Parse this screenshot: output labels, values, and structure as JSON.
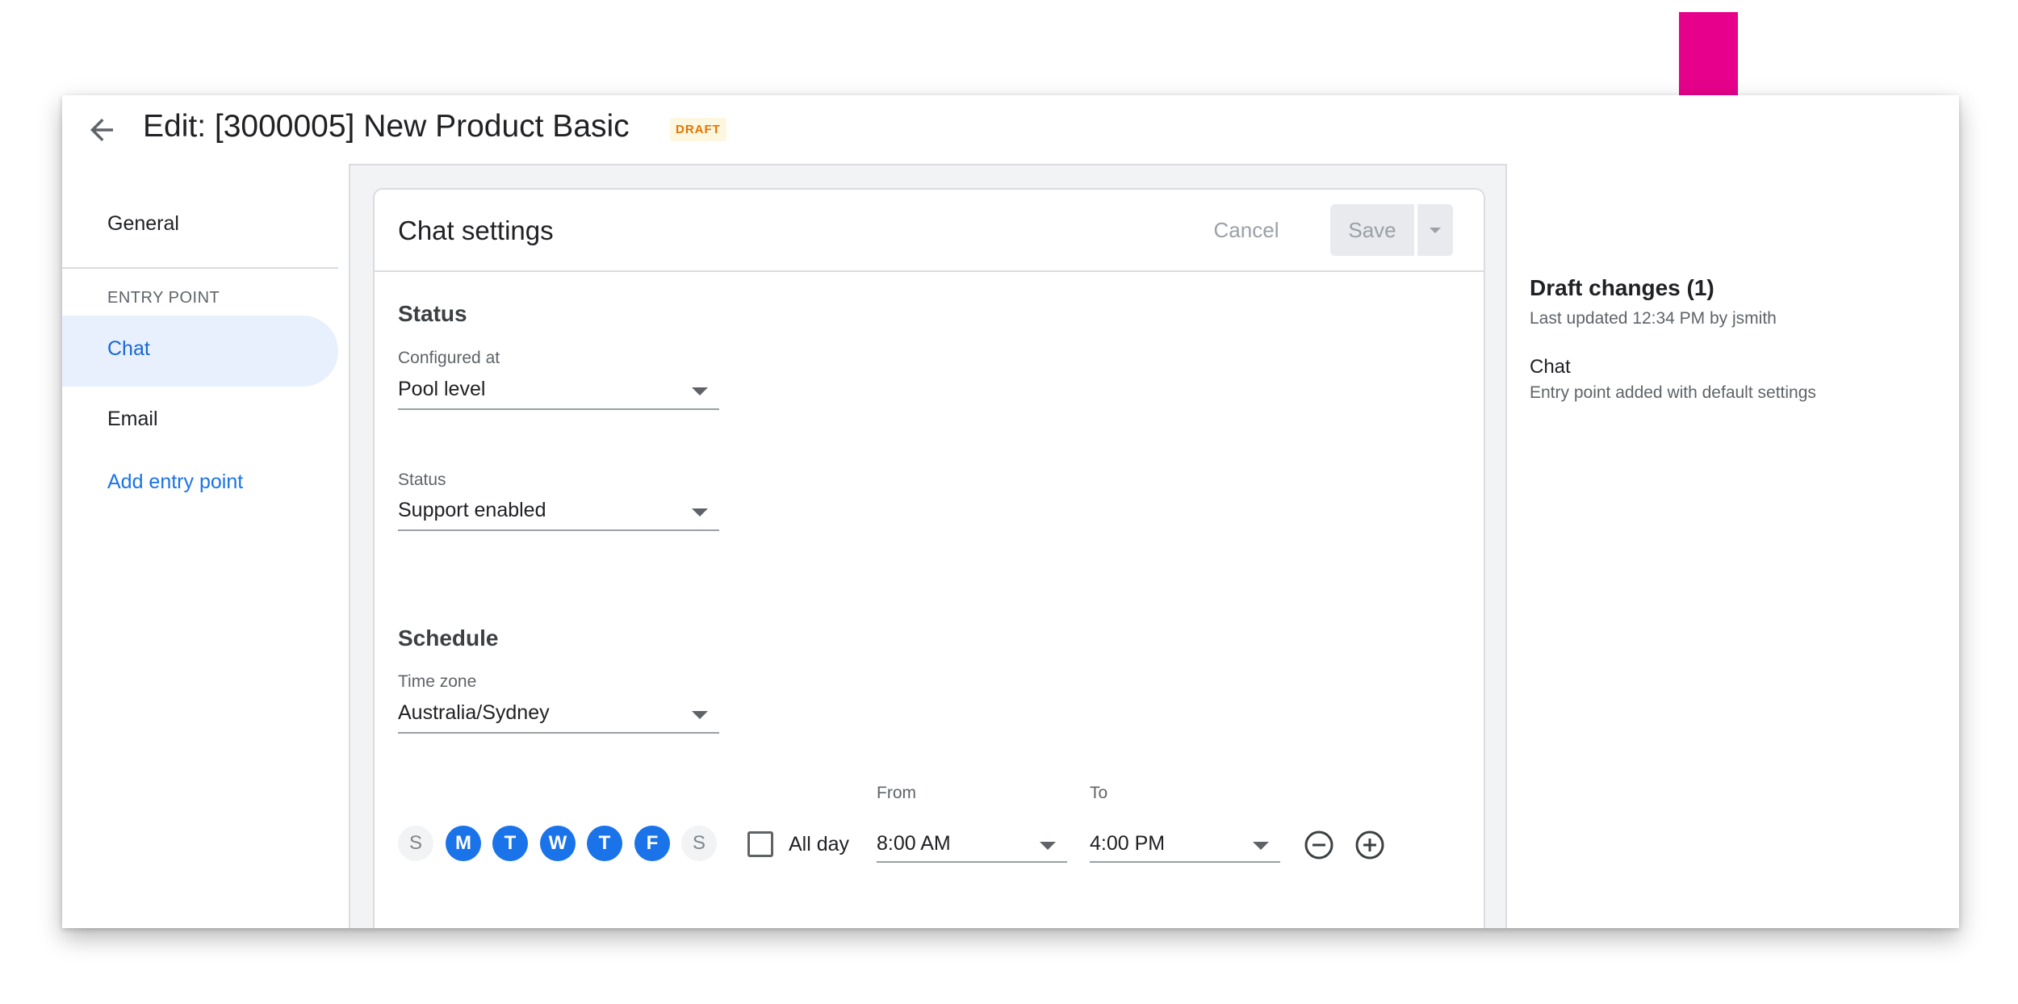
{
  "header": {
    "title": "Edit: [3000005] New Product Basic",
    "badge": "DRAFT"
  },
  "nav": {
    "general": "General",
    "section_label": "ENTRY POINT",
    "items": [
      {
        "label": "Chat",
        "selected": true
      },
      {
        "label": "Email",
        "selected": false
      }
    ],
    "add_label": "Add entry point"
  },
  "card": {
    "title": "Chat settings",
    "cancel_label": "Cancel",
    "save_label": "Save",
    "status_section": "Status",
    "configured_label": "Configured at",
    "configured_value": "Pool level",
    "status_label": "Status",
    "status_value": "Support enabled",
    "schedule_section": "Schedule",
    "timezone_label": "Time zone",
    "timezone_value": "Australia/Sydney",
    "days": [
      {
        "label": "S",
        "on": false
      },
      {
        "label": "M",
        "on": true
      },
      {
        "label": "T",
        "on": true
      },
      {
        "label": "W",
        "on": true
      },
      {
        "label": "T",
        "on": true
      },
      {
        "label": "F",
        "on": true
      },
      {
        "label": "S",
        "on": false
      }
    ],
    "allday_label": "All day",
    "allday_checked": false,
    "from_label": "From",
    "from_value": "8:00 AM",
    "to_label": "To",
    "to_value": "4:00 PM"
  },
  "draft_panel": {
    "title": "Draft changes (1)",
    "updated": "Last updated 12:34 PM by jsmith",
    "entry_title": "Chat",
    "entry_desc": "Entry point added with default settings"
  },
  "colors": {
    "accent": "#1a73e8",
    "annotation_arrow": "#e6008b",
    "draft_badge_text": "#e37400"
  }
}
